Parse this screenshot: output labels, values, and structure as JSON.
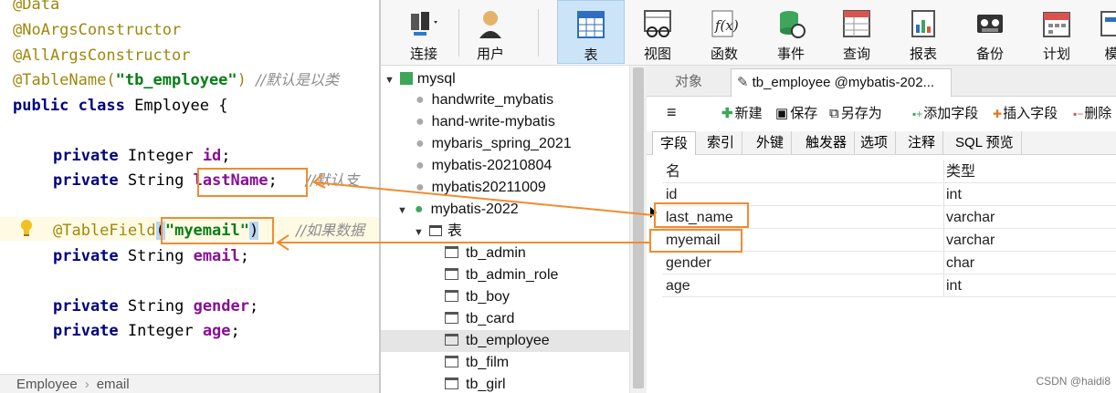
{
  "editor": {
    "lines": {
      "l0": "@Data",
      "l1": "@NoArgsConstructor",
      "l2": "@AllArgsConstructor",
      "l3_ann": "@TableName(",
      "l3_str": "\"tb_employee\"",
      "l3_close": ")",
      "l3_cmt": "//默认是以类",
      "l4_kw1": "public",
      "l4_kw2": "class",
      "l4_rest": "Employee {",
      "l5_kw": "private",
      "l5_type": "Integer",
      "l5_name": "id",
      "l5_end": ";",
      "l6_kw": "private",
      "l6_type": "String",
      "l6_name": "lastName",
      "l6_end": ";",
      "l6_cmt": "//默认支",
      "l7_ann": "@TableField",
      "l7_open": "(",
      "l7_str": "\"myemail\"",
      "l7_close": ")",
      "l7_cmt": "//如果数据",
      "l8_kw": "private",
      "l8_type": "String",
      "l8_name": "email",
      "l8_end": ";",
      "l9_kw": "private",
      "l9_type": "String",
      "l9_name": "gender",
      "l9_end": ";",
      "l10_kw": "private",
      "l10_type": "Integer",
      "l10_name": "age",
      "l10_end": ";"
    },
    "breadcrumb": [
      "Employee",
      "email"
    ],
    "breadcrumb_sep": "›"
  },
  "toolbar": {
    "items": [
      {
        "label": "连接",
        "icon": "connection-icon"
      },
      {
        "label": "用户",
        "icon": "user-icon"
      },
      {
        "label": "表",
        "icon": "table-icon",
        "active": true
      },
      {
        "label": "视图",
        "icon": "view-icon"
      },
      {
        "label": "函数",
        "icon": "function-icon"
      },
      {
        "label": "事件",
        "icon": "event-icon"
      },
      {
        "label": "查询",
        "icon": "query-icon"
      },
      {
        "label": "报表",
        "icon": "report-icon"
      },
      {
        "label": "备份",
        "icon": "backup-icon"
      },
      {
        "label": "计划",
        "icon": "schedule-icon"
      },
      {
        "label": "模",
        "icon": "model-icon"
      }
    ]
  },
  "tree": {
    "connection": "mysql",
    "databases": [
      "handwrite_mybatis",
      "hand-write-mybatis",
      "mybaris_spring_2021",
      "mybatis-20210804",
      "mybatis20211009"
    ],
    "open_db": "mybatis-2022",
    "tables_node": "表",
    "tables": [
      "tb_admin",
      "tb_admin_role",
      "tb_boy",
      "tb_card",
      "tb_employee",
      "tb_film",
      "tb_girl"
    ],
    "selected_table": "tb_employee"
  },
  "objpane": {
    "tab_objects": "对象",
    "tab_current": "tb_employee @mybatis-202...",
    "actions": {
      "new": "新建",
      "save": "保存",
      "save_as": "另存为",
      "add_field": "添加字段",
      "insert_field": "插入字段",
      "delete_field": "删除"
    },
    "subtabs": [
      "字段",
      "索引",
      "外键",
      "触发器",
      "选项",
      "注释",
      "SQL 预览"
    ],
    "grid": {
      "headers": [
        "名",
        "类型"
      ],
      "rows": [
        [
          "id",
          "int"
        ],
        [
          "last_name",
          "varchar"
        ],
        [
          "myemail",
          "varchar"
        ],
        [
          "gender",
          "char"
        ],
        [
          "age",
          "int"
        ]
      ]
    },
    "watermark": "CSDN @haidi8"
  },
  "colors": {
    "annotation_box": "#f08c2f",
    "toolbar_active": "#cce4f7"
  }
}
